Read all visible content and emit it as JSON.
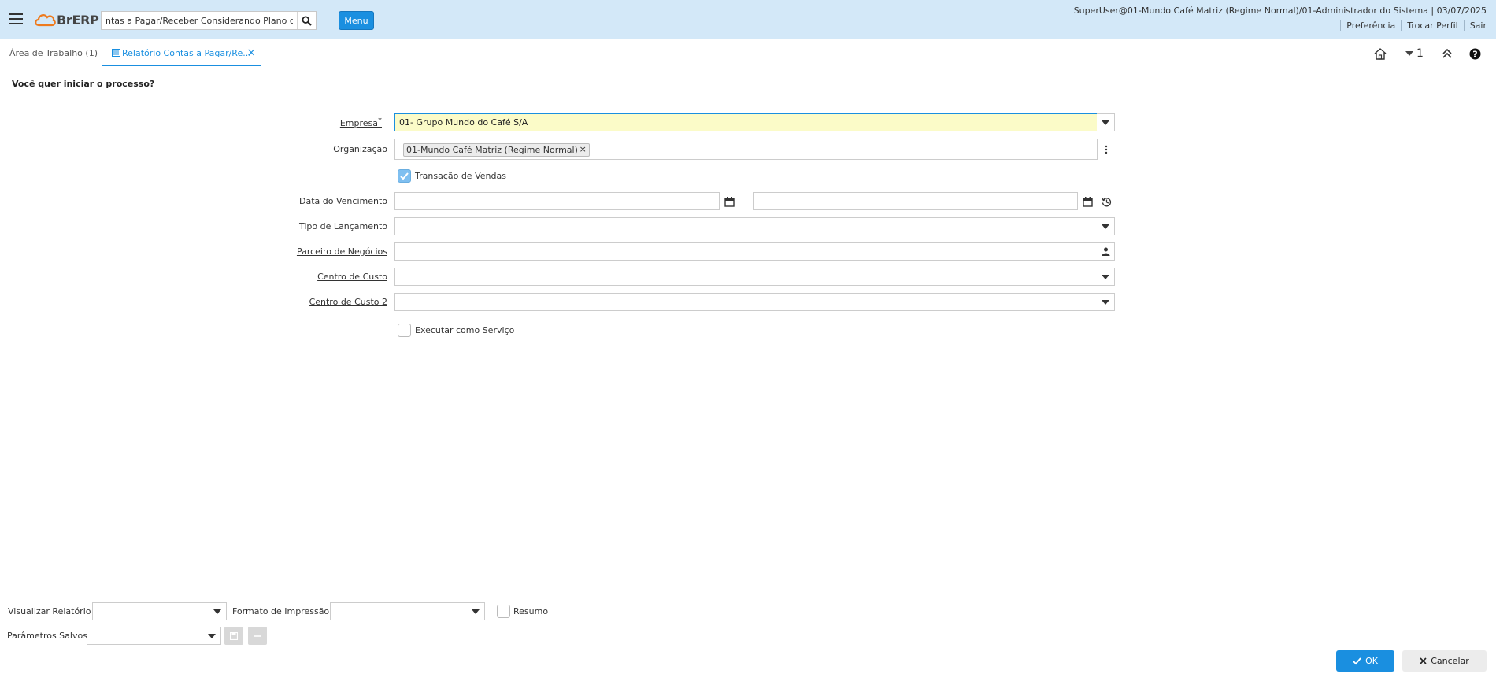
{
  "header": {
    "logo_text": "BrERP",
    "search_value": "ntas a Pagar/Receber Considerando Plano de Caixa",
    "menu_label": "Menu",
    "user_info": "SuperUser@01-Mundo Café Matriz (Regime Normal)/01-Administrador do Sistema | 03/07/2025",
    "links": [
      "Preferência",
      "Trocar Perfil",
      "Sair"
    ]
  },
  "tabs": {
    "workspace": "Área de Trabalho (1)",
    "active": "Relatório Contas a Pagar/Re...",
    "window_count": "1"
  },
  "form": {
    "question": "Você quer iniciar o processo?",
    "empresa_label": "Empresa",
    "empresa_required": "*",
    "empresa_value": "01- Grupo Mundo do Café S/A",
    "organizacao_label": "Organização",
    "organizacao_chip": "01-Mundo Café Matriz (Regime Normal)",
    "transacao_label": "Transação de Vendas",
    "transacao_checked": true,
    "data_vencimento_label": "Data do Vencimento",
    "data_vencimento_from": "",
    "data_vencimento_to": "",
    "tipo_lancamento_label": "Tipo de Lançamento",
    "parceiro_label": "Parceiro de Negócios",
    "centro_custo_label": "Centro de Custo",
    "centro_custo2_label": "Centro de Custo 2",
    "executar_servico_label": "Executar como Serviço",
    "executar_servico_checked": false
  },
  "bottom": {
    "visualizar_label": "Visualizar Relatório",
    "formato_label": "Formato de Impressão",
    "resumo_label": "Resumo",
    "parametros_label": "Parâmetros Salvos",
    "ok_label": "OK",
    "cancel_label": "Cancelar"
  },
  "colors": {
    "header_bg": "#d3e8f8",
    "accent": "#1a8fe0",
    "highlight_field": "#fbfbc8"
  },
  "icons": [
    "menu-icon",
    "search-icon",
    "calendar-icon",
    "history-icon",
    "person-icon",
    "more-vertical-icon",
    "home-icon",
    "collapse-icon",
    "help-icon",
    "save-icon",
    "delete-icon",
    "check-icon",
    "close-icon"
  ]
}
